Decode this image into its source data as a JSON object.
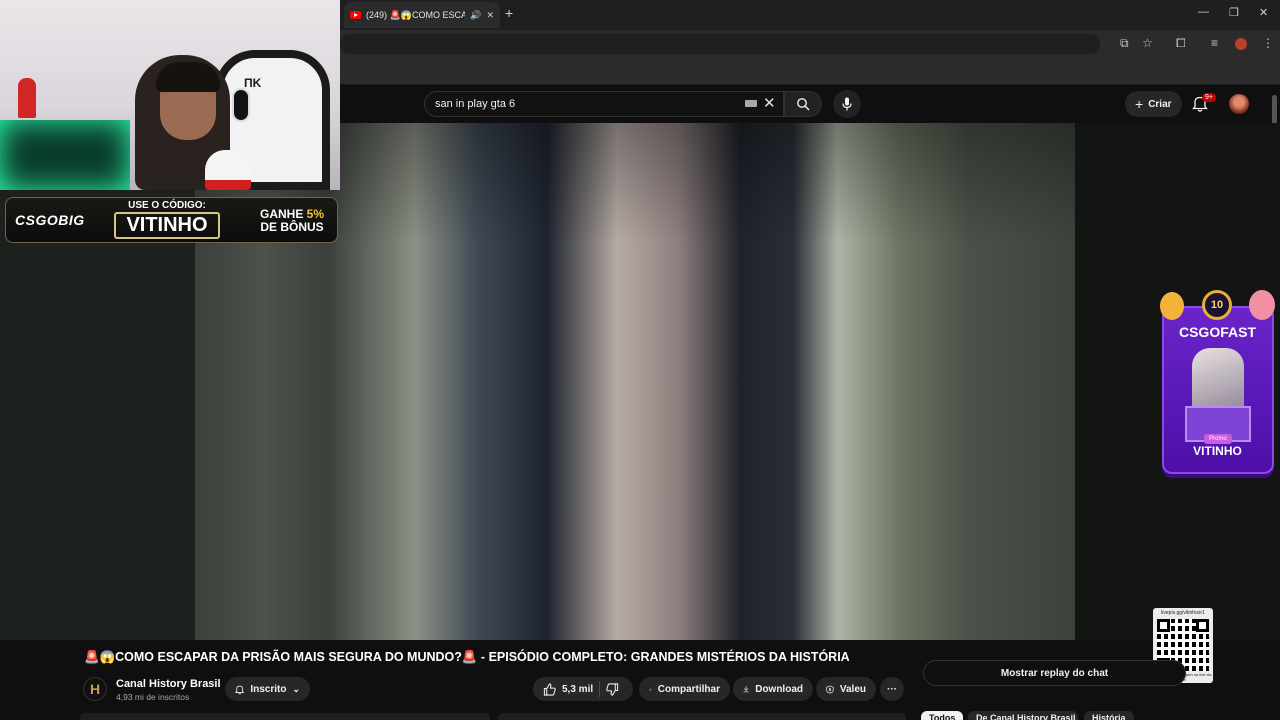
{
  "browser": {
    "tab_count": "(249)",
    "tab_title": "🚨😱COMO ESCAPAR",
    "new_tab": "+",
    "window_minimize": "—",
    "window_restore": "❐",
    "window_close": "✕"
  },
  "header": {
    "search_value": "san in play gta 6",
    "create_label": "Criar",
    "notifications_badge": "9+"
  },
  "overlays": {
    "webcam_logo": "ΠK",
    "promo_logo": "CSGOBIG",
    "promo_use_code": "USE O CÓDIGO:",
    "promo_code": "VITINHO",
    "promo_bonus_prefix": "GANHE",
    "promo_bonus_percent": "5%",
    "promo_bonus_suffix": "DE BÔNUS",
    "csgofast_badge": "10",
    "csgofast_title": "CSGOFAST",
    "csgofast_promo": "Promo",
    "csgofast_code": "VITINHO",
    "qr_url": "livepix.gg/vitinhozr1",
    "qr_note": "envie sua mensagem na live via pix!"
  },
  "video": {
    "title": "🚨😱COMO ESCAPAR DA PRISÃO MAIS SEGURA DO MUNDO?🚨 - EPISÓDIO COMPLETO: GRANDES MISTÉRIOS DA HISTÓRIA",
    "channel_logo": "H",
    "channel_name": "Canal History Brasil",
    "subscribers": "4,93 mi de inscritos",
    "subscribed_label": "Inscrito",
    "likes": "5,3 mil",
    "share_label": "Compartilhar",
    "download_label": "Download",
    "thanks_label": "Valeu",
    "more_label": "···"
  },
  "sidebar": {
    "chat_replay_label": "Mostrar replay do chat",
    "chips": [
      "Todos",
      "De Canal History Brasil",
      "História"
    ]
  },
  "colors": {
    "background": "#0f0f0f",
    "pill": "#272727",
    "accent_red": "#ff0000",
    "promo_gold": "#f2c144",
    "csgofast_purple": "#6a24c9"
  }
}
